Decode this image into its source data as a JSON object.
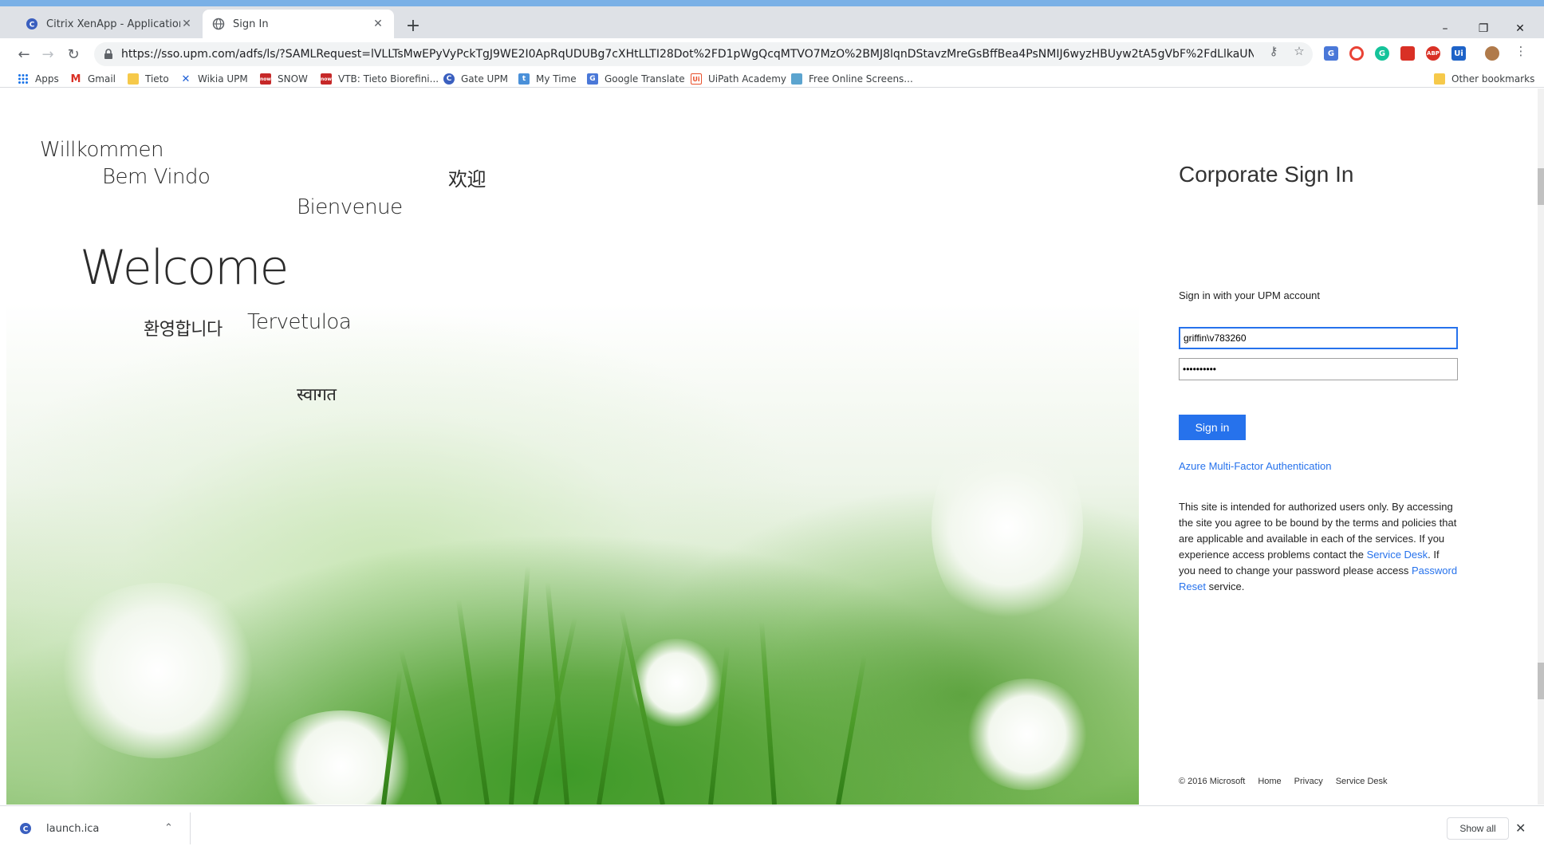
{
  "browser": {
    "tabs": [
      {
        "title": "Citrix XenApp - Applications",
        "active": false
      },
      {
        "title": "Sign In",
        "active": true
      }
    ],
    "new_tab_label": "+",
    "window_controls": {
      "minimize": "–",
      "restore": "❐",
      "close": "✕"
    },
    "url": "https://sso.upm.com/adfs/ls/?SAMLRequest=lVLLTsMwEPyVyPckTgJ9WE2I0ApRqUDUBg7cXHtLLTI28Dot%2FD1pWgQcqMTVO7MzO%2BMJ8lqnDStavzMreGsBffBea4PsNMIJ6wyzHBUyw2tA5gVbF%2FdLlkaUNc56K6wmQYElzitrZtZg...",
    "bookmarks": [
      {
        "label": "Apps",
        "icon": "apps-grid-icon"
      },
      {
        "label": "Gmail",
        "icon": "gmail-icon"
      },
      {
        "label": "Tieto",
        "icon": "folder-icon"
      },
      {
        "label": "Wikia UPM",
        "icon": "confluence-icon"
      },
      {
        "label": "SNOW",
        "icon": "servicenow-icon"
      },
      {
        "label": "VTB: Tieto Biorefini...",
        "icon": "servicenow-icon"
      },
      {
        "label": "Gate UPM",
        "icon": "citrix-icon"
      },
      {
        "label": "My Time",
        "icon": "mytime-icon"
      },
      {
        "label": "Google Translate",
        "icon": "translate-icon"
      },
      {
        "label": "UiPath Academy",
        "icon": "uipath-icon"
      },
      {
        "label": "Free Online Screens...",
        "icon": "screenshot-icon"
      }
    ],
    "other_bookmarks": "Other bookmarks"
  },
  "welcome_words": [
    {
      "text": "Willkommen"
    },
    {
      "text": "Bem Vindo"
    },
    {
      "text": "欢迎"
    },
    {
      "text": "Bienvenue"
    },
    {
      "text": "Welcome"
    },
    {
      "text": "환영합니다"
    },
    {
      "text": "Tervetuloa"
    },
    {
      "text": "स्वागत"
    }
  ],
  "signin": {
    "title": "Corporate Sign In",
    "subtitle": "Sign in with your UPM account",
    "username_value": "griffin\\v783260",
    "password_value": "••••••••••",
    "button_label": "Sign in",
    "mfa_link": "Azure Multi-Factor Authentication",
    "disclaimer": {
      "part1": "This site is intended for authorized users only. By accessing the site you agree to be bound by the terms and policies that are applicable and available in each of the services. If you experience access problems contact the ",
      "service_desk_link": "Service Desk",
      "part2": ". If you need to change your password please access ",
      "password_reset_link": "Password Reset",
      "part3": " service."
    },
    "footer": {
      "copyright": "© 2016 Microsoft",
      "home": "Home",
      "privacy": "Privacy",
      "service_desk": "Service Desk"
    }
  },
  "downloads": {
    "file_name": "launch.ica",
    "show_all": "Show all"
  },
  "colors": {
    "accent_blue": "#2672ec",
    "chrome_frame": "#dee1e6"
  }
}
